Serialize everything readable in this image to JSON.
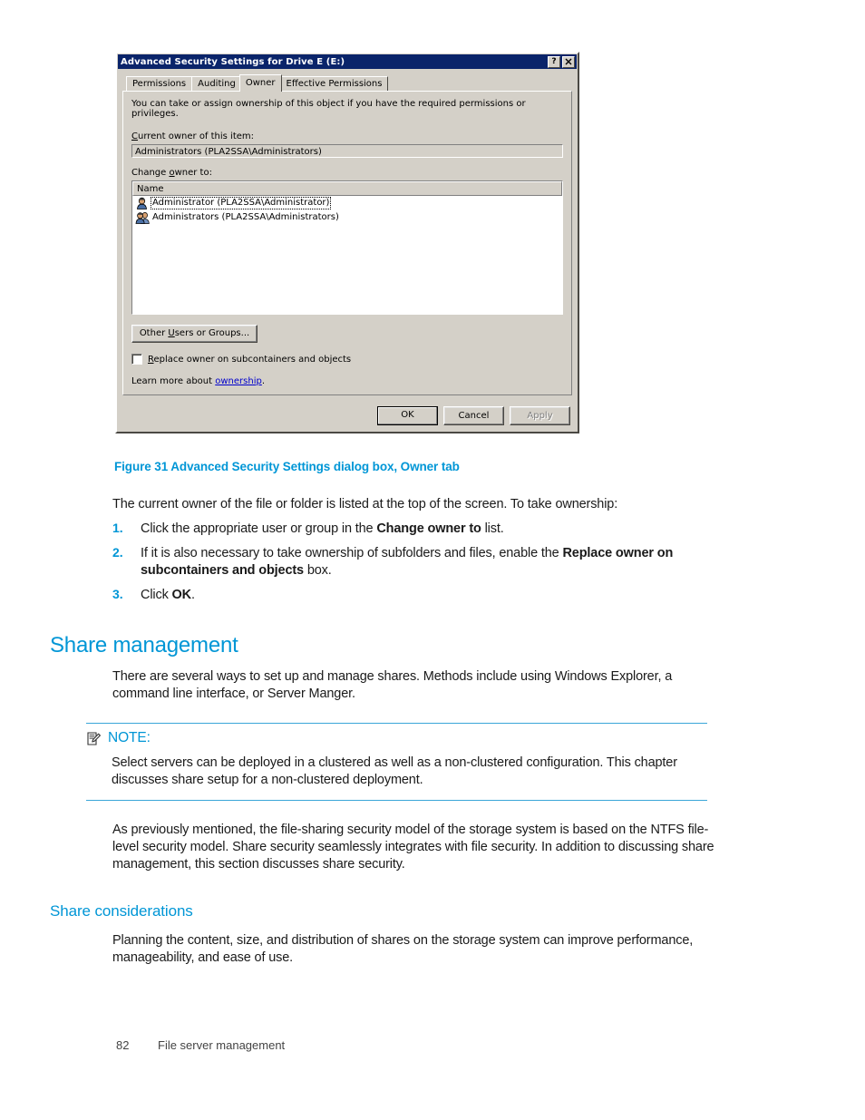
{
  "dialog": {
    "title": "Advanced Security Settings for Drive E (E:)",
    "help_button": "?",
    "close_button": "✕",
    "tabs": [
      {
        "label": "Permissions",
        "active": false
      },
      {
        "label": "Auditing",
        "active": false
      },
      {
        "label": "Owner",
        "active": true
      },
      {
        "label": "Effective Permissions",
        "active": false
      }
    ],
    "intro": "You can take or assign ownership of this object if you have the required permissions or privileges.",
    "current_owner_label": "Current owner of this item:",
    "current_owner_value": "Administrators (PLA2SSA\\Administrators)",
    "change_owner_label": "Change owner to:",
    "list_header": "Name",
    "list_rows": [
      {
        "label": "Administrator (PLA2SSA\\Administrator)",
        "icon": "user-icon",
        "focused": true
      },
      {
        "label": "Administrators (PLA2SSA\\Administrators)",
        "icon": "group-icon",
        "focused": false
      }
    ],
    "other_users_button": "Other Users or Groups...",
    "replace_owner_checkbox": "Replace owner on subcontainers and objects",
    "replace_owner_checked": false,
    "learn_more_prefix": "Learn more about ",
    "learn_more_link": "ownership",
    "learn_more_suffix": ".",
    "buttons": {
      "ok": "OK",
      "cancel": "Cancel",
      "apply": "Apply",
      "apply_disabled": true
    }
  },
  "document": {
    "figure_caption": "Figure 31 Advanced Security Settings dialog box, Owner tab",
    "intro_paragraph": "The current owner of the file or folder is listed at the top of the screen. To take ownership:",
    "steps": [
      {
        "number": "1.",
        "parts": [
          {
            "text": "Click the appropriate user or group in the ",
            "bold": false
          },
          {
            "text": "Change owner to",
            "bold": true
          },
          {
            "text": " list.",
            "bold": false
          }
        ]
      },
      {
        "number": "2.",
        "parts": [
          {
            "text": "If it is also necessary to take ownership of subfolders and files, enable the ",
            "bold": false
          },
          {
            "text": "Replace owner on subcontainers and objects",
            "bold": true
          },
          {
            "text": " box.",
            "bold": false
          }
        ]
      },
      {
        "number": "3.",
        "parts": [
          {
            "text": "Click ",
            "bold": false
          },
          {
            "text": "OK",
            "bold": true
          },
          {
            "text": ".",
            "bold": false
          }
        ]
      }
    ],
    "share_management_heading": "Share management",
    "share_management_paragraph": "There are several ways to set up and manage shares. Methods include using Windows Explorer, a command line interface, or Server Manger.",
    "note": {
      "icon": "note-icon",
      "title": "NOTE:",
      "body": "Select servers can be deployed in a clustered as well as a non-clustered configuration. This chapter discusses share setup for a non-clustered deployment."
    },
    "ntfs_paragraph": "As previously mentioned, the file-sharing security model of the storage system is based on the NTFS file-level security model. Share security seamlessly integrates with file security. In addition to discussing share management, this section discusses share security.",
    "share_considerations_heading": "Share considerations",
    "share_considerations_paragraph": "Planning the content, size, and distribution of shares on the storage system can improve performance, manageability, and ease of use."
  },
  "footer": {
    "page_number": "82",
    "section": "File server management"
  },
  "colors": {
    "accent": "#0096d6",
    "titlebar": "#0a246a",
    "dialog_face": "#d4d0c8",
    "link": "#0000cc"
  }
}
